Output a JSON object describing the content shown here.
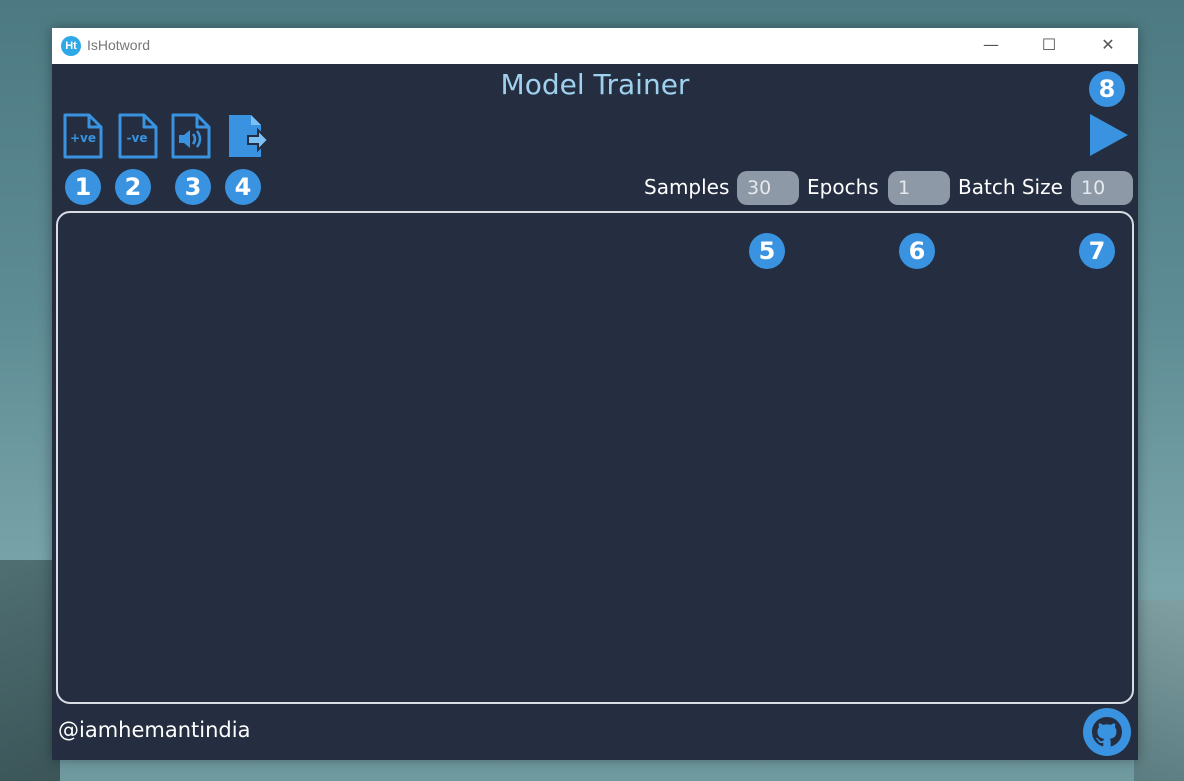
{
  "window": {
    "app_title": "IsHotword",
    "logo_text": "Ht",
    "controls": {
      "minimize": "—",
      "maximize": "☐",
      "close": "✕"
    }
  },
  "header": {
    "title": "Model Trainer"
  },
  "toolbar": {
    "icons": [
      {
        "name": "positive-file-icon",
        "label": "+ve",
        "badge": "1"
      },
      {
        "name": "negative-file-icon",
        "label": "-ve",
        "badge": "2"
      },
      {
        "name": "audio-file-icon",
        "label": "",
        "badge": "3"
      },
      {
        "name": "export-file-icon",
        "label": "",
        "badge": "4"
      }
    ],
    "play_badge": "8",
    "play_icon": "play-icon"
  },
  "params": {
    "samples_label": "Samples",
    "samples_value": "30",
    "samples_badge": "5",
    "epochs_label": "Epochs",
    "epochs_value": "1",
    "epochs_badge": "6",
    "batch_label": "Batch Size",
    "batch_value": "10",
    "batch_badge": "7"
  },
  "footer": {
    "handle": "@iamhemantindia",
    "github_icon": "github-icon"
  },
  "colors": {
    "accent": "#3a93e0",
    "background": "#242e40",
    "title": "#9fd1ee",
    "input_bg": "#8e99a7"
  }
}
